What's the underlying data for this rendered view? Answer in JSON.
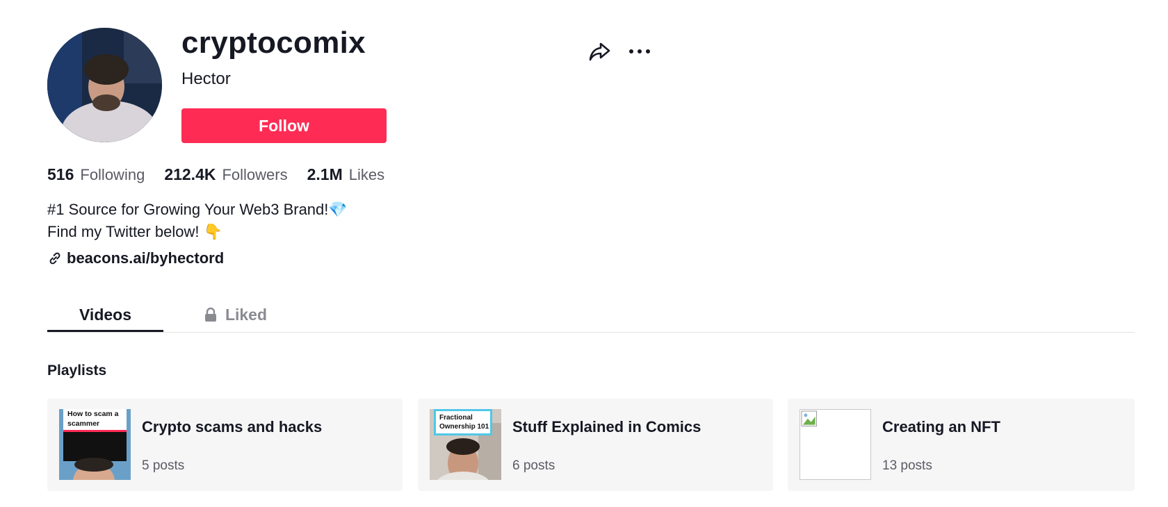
{
  "profile": {
    "username": "cryptocomix",
    "nickname": "Hector",
    "follow_label": "Follow",
    "accent_color": "#fe2c55"
  },
  "actions": {
    "share_icon": "share-icon",
    "more_icon": "more-icon"
  },
  "stats": {
    "following_count": "516",
    "following_label": "Following",
    "followers_count": "212.4K",
    "followers_label": "Followers",
    "likes_count": "2.1M",
    "likes_label": "Likes"
  },
  "bio": {
    "line1": "#1 Source for Growing Your Web3 Brand!💎",
    "line2": "Find my Twitter below! 👇",
    "link": "beacons.ai/byhectord"
  },
  "tabs": [
    {
      "label": "Videos",
      "active": true
    },
    {
      "label": "Liked",
      "active": false,
      "icon": "lock-icon"
    }
  ],
  "playlists": {
    "heading": "Playlists",
    "items": [
      {
        "title": "Crypto scams and hacks",
        "count": "5 posts",
        "thumb_caption": "How to scam a scammer"
      },
      {
        "title": "Stuff Explained in Comics",
        "count": "6 posts",
        "thumb_caption": "Fractional Ownership 101"
      },
      {
        "title": "Creating an NFT",
        "count": "13 posts"
      }
    ]
  }
}
